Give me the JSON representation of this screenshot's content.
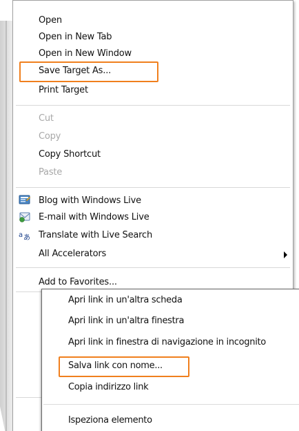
{
  "ie_menu": {
    "items": [
      {
        "label": "Open",
        "enabled": true
      },
      {
        "label": "Open in New Tab",
        "enabled": true
      },
      {
        "label": "Open in New Window",
        "enabled": true
      },
      {
        "label": "Save Target As...",
        "enabled": true,
        "highlighted": true
      },
      {
        "label": "Print Target",
        "enabled": true
      },
      {
        "label": "Cut",
        "enabled": false
      },
      {
        "label": "Copy",
        "enabled": false
      },
      {
        "label": "Copy Shortcut",
        "enabled": true
      },
      {
        "label": "Paste",
        "enabled": false
      },
      {
        "label": "Blog with Windows Live",
        "enabled": true,
        "icon": "blog-icon"
      },
      {
        "label": "E-mail with Windows Live",
        "enabled": true,
        "icon": "email-icon"
      },
      {
        "label": "Translate with Live Search",
        "enabled": true,
        "icon": "translate-icon"
      },
      {
        "label": "All Accelerators",
        "enabled": true,
        "submenu": true
      },
      {
        "label": "Add to Favorites...",
        "enabled": true
      }
    ]
  },
  "chrome_menu": {
    "items": [
      {
        "label": "Apri link in un'altra scheda"
      },
      {
        "label": "Apri link in un'altra finestra"
      },
      {
        "label": "Apri link in finestra di navigazione in incognito"
      },
      {
        "label": "Salva link con nome...",
        "highlighted": true
      },
      {
        "label": "Copia indirizzo link"
      },
      {
        "label": "Ispeziona elemento"
      }
    ]
  },
  "colors": {
    "highlight_border": "#f07f1d",
    "disabled_text": "#a8a8a8"
  }
}
